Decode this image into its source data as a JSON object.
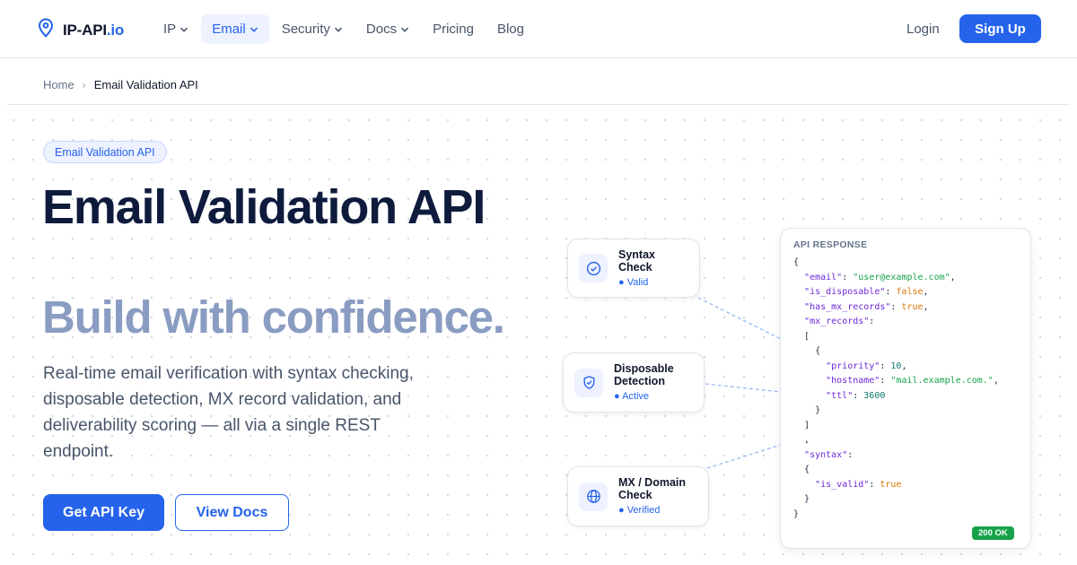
{
  "brand": {
    "name": "IP-API",
    "tld": ".io",
    "accent": "#2563eb"
  },
  "nav": [
    {
      "label": "IP",
      "dropdown": true,
      "active": false
    },
    {
      "label": "Email",
      "dropdown": true,
      "active": true
    },
    {
      "label": "Security",
      "dropdown": true,
      "active": false
    },
    {
      "label": "Docs",
      "dropdown": true,
      "active": false
    },
    {
      "label": "Pricing",
      "dropdown": false,
      "active": false
    },
    {
      "label": "Blog",
      "dropdown": false,
      "active": false
    }
  ],
  "auth": {
    "login": "Login",
    "signup": "Sign Up"
  },
  "breadcrumb": {
    "home": "Home",
    "separator": "›",
    "current": "Email Validation API"
  },
  "hero": {
    "badge": "Email Validation API",
    "title": "Email Validation API",
    "subtitle": "Build with confidence.",
    "description": "Real-time email verification with syntax checking, disposable detection, MX record validation, and deliverability scoring — all via a single REST endpoint.",
    "cta_primary": "Get API Key",
    "cta_secondary": "View Docs"
  },
  "features": [
    {
      "title": "Syntax Check",
      "status": "● Valid",
      "icon": "check-circle-icon"
    },
    {
      "title": "Disposable Detection",
      "status": "● Active",
      "icon": "shield-icon"
    },
    {
      "title": "MX / Domain Check",
      "status": "● Verified",
      "icon": "globe-icon"
    }
  ],
  "api_response": {
    "heading": "API RESPONSE",
    "email": "user@example.com",
    "is_disposable": "false",
    "has_mx_records": "true",
    "priority": "10",
    "hostname": "mail.example.com.",
    "ttl": "3600",
    "is_valid": "true",
    "status": "200 OK"
  },
  "colors": {
    "success": "#16a34a",
    "heading": "#0f1b3d",
    "subheading": "#8a9cc2"
  }
}
